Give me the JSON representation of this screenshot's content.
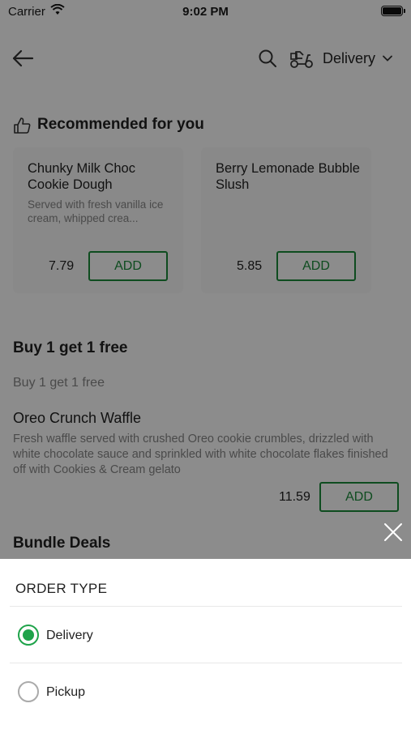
{
  "status_bar": {
    "carrier": "Carrier",
    "time": "9:02 PM"
  },
  "header": {
    "order_type": "Delivery",
    "icons": [
      "back-arrow-icon",
      "search-icon",
      "scooter-icon",
      "chevron-down-icon"
    ]
  },
  "recommended": {
    "title": "Recommended for you",
    "items": [
      {
        "name": "Chunky Milk Choc Cookie Dough",
        "description": "Served with fresh vanilla ice cream, whipped crea...",
        "price": "7.79",
        "add_label": "ADD"
      },
      {
        "name": "Berry Lemonade Bubble Slush",
        "description": "",
        "price": "5.85",
        "add_label": "ADD"
      }
    ]
  },
  "promo": {
    "title": "Buy 1 get 1 free",
    "subtitle": "Buy 1 get 1 free",
    "item": {
      "name": "Oreo Crunch Waffle",
      "description": "Fresh waffle served with crushed Oreo cookie crumbles, drizzled with white chocolate sauce and sprinkled with white chocolate flakes finished off with Cookies & Cream gelato",
      "price": "11.59",
      "add_label": "ADD"
    }
  },
  "bundle": {
    "title": "Bundle Deals"
  },
  "order_sheet": {
    "title": "ORDER TYPE",
    "options": [
      {
        "label": "Delivery",
        "selected": true
      },
      {
        "label": "Pickup",
        "selected": false
      }
    ]
  },
  "colors": {
    "accent_green": "#1fa34a",
    "add_button_green": "#1a8a3a",
    "overlay": "rgba(0,0,0,0.45)"
  }
}
